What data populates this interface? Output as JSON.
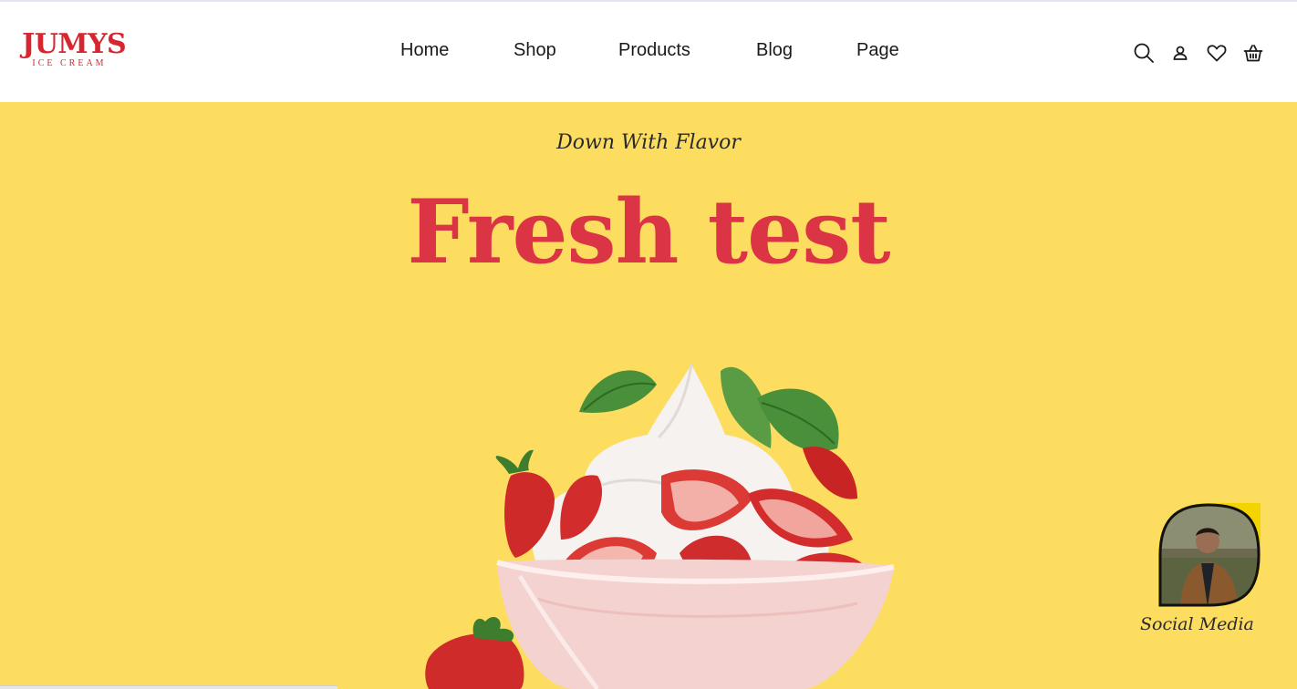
{
  "brand": {
    "logo_word": "JUMYS",
    "logo_sub": "ICE CREAM",
    "color": "#d7262f"
  },
  "nav": {
    "items": [
      {
        "label": "Home"
      },
      {
        "label": "Shop"
      },
      {
        "label": "Products"
      },
      {
        "label": "Blog"
      },
      {
        "label": "Page"
      }
    ]
  },
  "header_icons": [
    "search-icon",
    "user-icon",
    "heart-icon",
    "basket-icon"
  ],
  "hero": {
    "tagline": "Down With Flavor",
    "headline": "Fresh test",
    "background": "#fddd60",
    "headline_color": "#db3545"
  },
  "social": {
    "label": "Social Media",
    "frame_color": "#f3d400"
  }
}
